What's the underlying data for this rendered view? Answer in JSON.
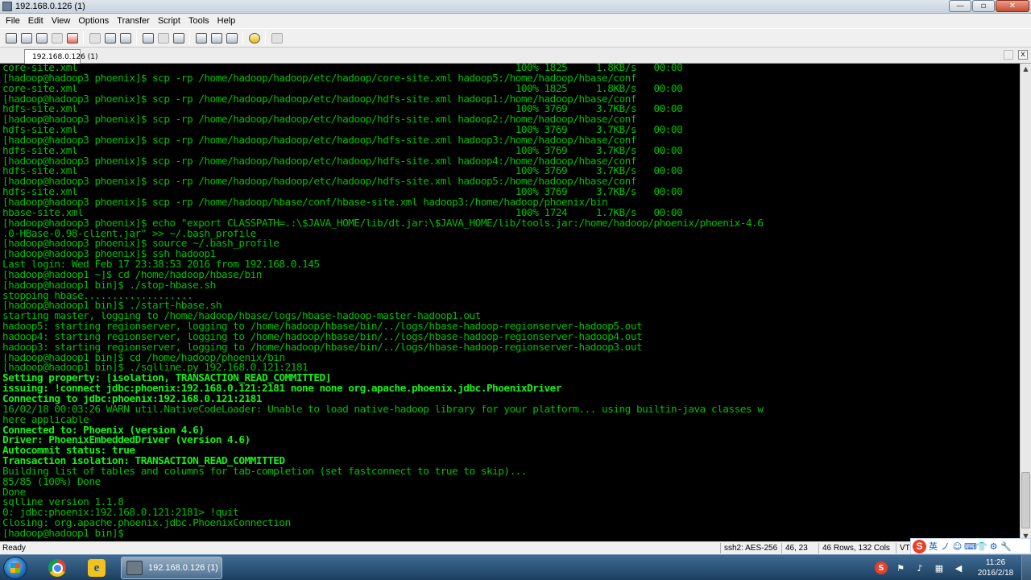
{
  "window": {
    "title": "192.168.0.126 (1)",
    "buttons": [
      "—",
      "▫",
      "✕"
    ]
  },
  "menu": [
    "File",
    "Edit",
    "View",
    "Options",
    "Transfer",
    "Script",
    "Tools",
    "Help"
  ],
  "toolbar_icons": [
    "connect-icon",
    "quick-connect-icon",
    "connect-tab-icon",
    "reconnect-icon",
    "disconnect-icon",
    "copy-icon",
    "paste-icon",
    "find-icon",
    "print-icon",
    "print-setup-icon",
    "print-preview-icon",
    "session-options-icon",
    "global-options-icon",
    "keymap-icon",
    "help-icon",
    "sftp-icon"
  ],
  "tab": {
    "label": "192.168.0.126 (1)",
    "close": "x"
  },
  "terminal": {
    "lines": [
      {
        "text": "core-site.xml                                                                            100% 1825     1.8KB/s   00:00",
        "bright": false
      },
      {
        "text": "[hadoop@hadoop3 phoenix]$ scp -rp /home/hadoop/hadoop/etc/hadoop/core-site.xml hadoop5:/home/hadoop/hbase/conf",
        "bright": false
      },
      {
        "text": "core-site.xml                                                                            100% 1825     1.8KB/s   00:00",
        "bright": false
      },
      {
        "text": "[hadoop@hadoop3 phoenix]$ scp -rp /home/hadoop/hadoop/etc/hadoop/hdfs-site.xml hadoop1:/home/hadoop/hbase/conf",
        "bright": false
      },
      {
        "text": "hdfs-site.xml                                                                            100% 3769     3.7KB/s   00:00",
        "bright": false
      },
      {
        "text": "[hadoop@hadoop3 phoenix]$ scp -rp /home/hadoop/hadoop/etc/hadoop/hdfs-site.xml hadoop2:/home/hadoop/hbase/conf",
        "bright": false
      },
      {
        "text": "hdfs-site.xml                                                                            100% 3769     3.7KB/s   00:00",
        "bright": false
      },
      {
        "text": "[hadoop@hadoop3 phoenix]$ scp -rp /home/hadoop/hadoop/etc/hadoop/hdfs-site.xml hadoop3:/home/hadoop/hbase/conf",
        "bright": false
      },
      {
        "text": "hdfs-site.xml                                                                            100% 3769     3.7KB/s   00:00",
        "bright": false
      },
      {
        "text": "[hadoop@hadoop3 phoenix]$ scp -rp /home/hadoop/hadoop/etc/hadoop/hdfs-site.xml hadoop4:/home/hadoop/hbase/conf",
        "bright": false
      },
      {
        "text": "hdfs-site.xml                                                                            100% 3769     3.7KB/s   00:00",
        "bright": false
      },
      {
        "text": "[hadoop@hadoop3 phoenix]$ scp -rp /home/hadoop/hadoop/etc/hadoop/hdfs-site.xml hadoop5:/home/hadoop/hbase/conf",
        "bright": false
      },
      {
        "text": "hdfs-site.xml                                                                            100% 3769     3.7KB/s   00:00",
        "bright": false
      },
      {
        "text": "[hadoop@hadoop3 phoenix]$ scp -rp /home/hadoop/hbase/conf/hbase-site.xml hadoop3:/home/hadoop/phoenix/bin",
        "bright": false
      },
      {
        "text": "hbase-site.xml                                                                           100% 1724     1.7KB/s   00:00",
        "bright": false
      },
      {
        "text": "[hadoop@hadoop3 phoenix]$ echo \"export CLASSPATH=.:\\$JAVA_HOME/lib/dt.jar:\\$JAVA_HOME/lib/tools.jar:/home/hadoop/phoenix/phoenix-4.6",
        "bright": false
      },
      {
        "text": ".0-HBase-0.98-client.jar\" >> ~/.bash_profile",
        "bright": false
      },
      {
        "text": "[hadoop@hadoop3 phoenix]$ source ~/.bash_profile",
        "bright": false
      },
      {
        "text": "[hadoop@hadoop3 phoenix]$ ssh hadoop1",
        "bright": false
      },
      {
        "text": "Last login: Wed Feb 17 23:38:53 2016 from 192.168.0.145",
        "bright": false
      },
      {
        "text": "[hadoop@hadoop1 ~]$ cd /home/hadoop/hbase/bin",
        "bright": false
      },
      {
        "text": "[hadoop@hadoop1 bin]$ ./stop-hbase.sh",
        "bright": false
      },
      {
        "text": "stopping hbase...................",
        "bright": false
      },
      {
        "text": "[hadoop@hadoop1 bin]$ ./start-hbase.sh",
        "bright": false
      },
      {
        "text": "starting master, logging to /home/hadoop/hbase/logs/hbase-hadoop-master-hadoop1.out",
        "bright": false
      },
      {
        "text": "hadoop5: starting regionserver, logging to /home/hadoop/hbase/bin/../logs/hbase-hadoop-regionserver-hadoop5.out",
        "bright": false
      },
      {
        "text": "hadoop4: starting regionserver, logging to /home/hadoop/hbase/bin/../logs/hbase-hadoop-regionserver-hadoop4.out",
        "bright": false
      },
      {
        "text": "hadoop3: starting regionserver, logging to /home/hadoop/hbase/bin/../logs/hbase-hadoop-regionserver-hadoop3.out",
        "bright": false
      },
      {
        "text": "[hadoop@hadoop1 bin]$ cd /home/hadoop/phoenix/bin",
        "bright": false
      },
      {
        "text": "[hadoop@hadoop1 bin]$ ./sqlline.py 192.168.0.121:2181",
        "bright": false
      },
      {
        "text": "Setting property: [isolation, TRANSACTION_READ_COMMITTED]",
        "bright": true
      },
      {
        "text": "issuing: !connect jdbc:phoenix:192.168.0.121:2181 none none org.apache.phoenix.jdbc.PhoenixDriver",
        "bright": true
      },
      {
        "text": "Connecting to jdbc:phoenix:192.168.0.121:2181",
        "bright": true
      },
      {
        "text": "16/02/18 00:03:26 WARN util.NativeCodeLoader: Unable to load native-hadoop library for your platform... using builtin-java classes w",
        "bright": false
      },
      {
        "text": "here applicable",
        "bright": false
      },
      {
        "text": "Connected to: Phoenix (version 4.6)",
        "bright": true
      },
      {
        "text": "Driver: PhoenixEmbeddedDriver (version 4.6)",
        "bright": true
      },
      {
        "text": "Autocommit status: true",
        "bright": true
      },
      {
        "text": "Transaction isolation: TRANSACTION_READ_COMMITTED",
        "bright": true
      },
      {
        "text": "Building list of tables and columns for tab-completion (set fastconnect to true to skip)...",
        "bright": false
      },
      {
        "text": "85/85 (100%) Done",
        "bright": false
      },
      {
        "text": "Done",
        "bright": false
      },
      {
        "text": "sqlline version 1.1.8",
        "bright": false
      },
      {
        "text": "0: jdbc:phoenix:192.168.0.121:2181> !quit",
        "bright": false
      },
      {
        "text": "Closing: org.apache.phoenix.jdbc.PhoenixConnection",
        "bright": false
      },
      {
        "text": "[hadoop@hadoop1 bin]$ ",
        "bright": false
      }
    ]
  },
  "scrollbar": {
    "up": "▲",
    "down": "▼"
  },
  "status": {
    "ready": "Ready",
    "cipher": "ssh2: AES-256",
    "cursor": "46,  23",
    "size": "46 Rows, 132 Cols",
    "terminal_type": "VT1"
  },
  "ime": {
    "logo": "S",
    "items": [
      "英",
      "ノ",
      "☺",
      "⌨",
      "👕",
      "⚙",
      "🔧"
    ]
  },
  "taskbar": {
    "window_label": "192.168.0.126 (1)",
    "ie_glyph": "e",
    "tray_icons": [
      {
        "name": "sogou-tray-icon",
        "glyph": "S"
      },
      {
        "name": "flag-icon",
        "glyph": "⚑"
      },
      {
        "name": "volume-icon",
        "glyph": "♪"
      },
      {
        "name": "network-icon",
        "glyph": "▦"
      },
      {
        "name": "speaker-icon",
        "glyph": "◀"
      }
    ],
    "clock_time": "11:26",
    "clock_date": "2016/2/18"
  }
}
